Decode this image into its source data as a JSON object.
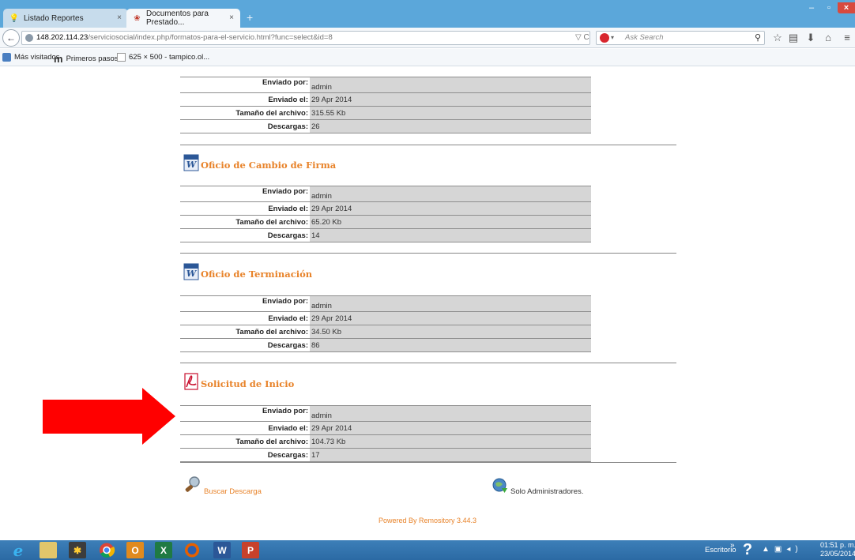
{
  "browser": {
    "tabs": [
      {
        "title": "Listado Reportes",
        "close": "×"
      },
      {
        "title": "Documentos para Prestado...",
        "close": "×"
      }
    ],
    "new_tab": "+",
    "window_controls": {
      "minimize": "–",
      "maximize": "▫",
      "close": "×"
    },
    "url_host": "148.202.114.23",
    "url_path": "/serviciosocial/index.php/formatos-para-el-servicio.html?func=select&id=8",
    "url_tools": "▽ C",
    "search_placeholder": "Ask Search",
    "bookmarks": [
      {
        "label": "Más visitados",
        "icon": "firefox-bookmark-icon"
      },
      {
        "label": "Primeros pasos",
        "icon": "m-logo-icon"
      },
      {
        "label": "625 × 500 - tampico.ol...",
        "icon": "page-icon"
      }
    ]
  },
  "fields": {
    "sent_by": "Enviado por:",
    "sent_on": "Enviado el:",
    "file_size": "Tamaño del archivo:",
    "downloads": "Descargas:"
  },
  "documents": [
    {
      "title": "",
      "icon": "none",
      "sent_by": "admin",
      "sent_on": "29 Apr 2014",
      "size": "315.55 Kb",
      "downloads": "26"
    },
    {
      "title": "Oficio de Cambio de Firma",
      "icon": "word-icon",
      "sent_by": "admin",
      "sent_on": "29 Apr 2014",
      "size": "65.20 Kb",
      "downloads": "14"
    },
    {
      "title": "Oficio de Terminación",
      "icon": "word-icon",
      "sent_by": "admin",
      "sent_on": "29 Apr 2014",
      "size": "34.50 Kb",
      "downloads": "86"
    },
    {
      "title": "Solicitud de Inicio",
      "icon": "pdf-icon",
      "sent_by": "admin",
      "sent_on": "29 Apr 2014",
      "size": "104.73 Kb",
      "downloads": "17"
    }
  ],
  "footer": {
    "search_link": "Buscar Descarga",
    "admin_only": "Solo Administradores.",
    "powered": "Powered By Remository 3.44.3"
  },
  "annotation": {
    "arrow_color": "#ff0000"
  },
  "colors": {
    "accent": "#e8832a",
    "value_bg": "#d6d6d6",
    "titlebar": "#5ba7da"
  },
  "taskbar": {
    "desktop_label": "Escritorio",
    "chevron": "»",
    "help": "?",
    "time": "01:51 p. m.",
    "date": "23/05/2014",
    "apps": [
      "ie-icon",
      "explorer-icon",
      "paint-icon",
      "chrome-icon",
      "outlook-icon",
      "excel-icon",
      "firefox-icon",
      "word-icon",
      "powerpoint-icon"
    ]
  }
}
